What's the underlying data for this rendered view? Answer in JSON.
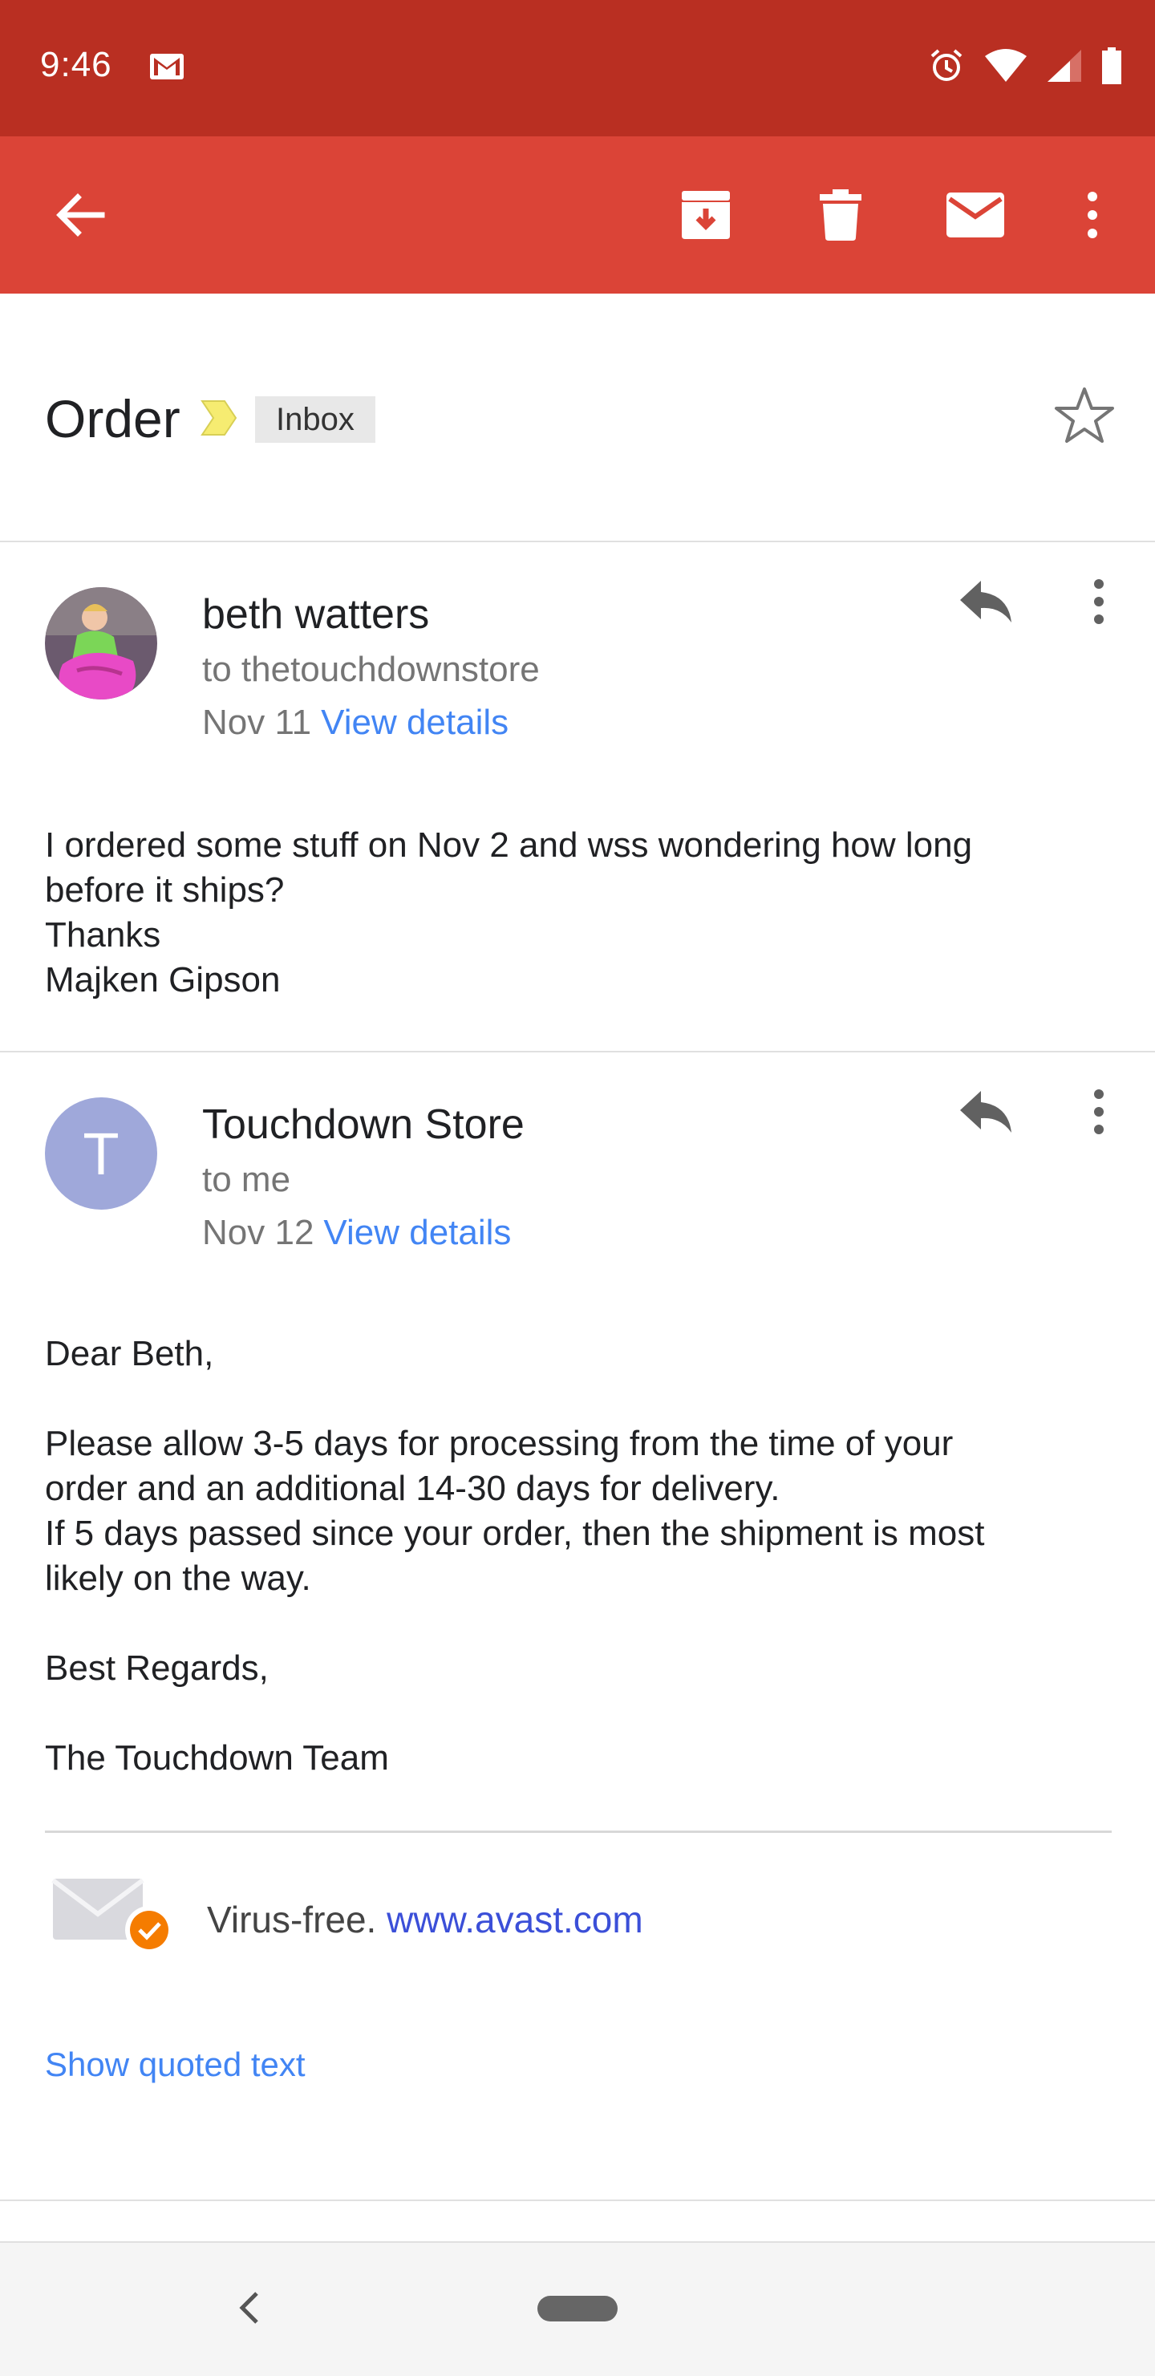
{
  "status_bar": {
    "time": "9:46",
    "background": "#b92f22"
  },
  "app_bar": {
    "background": "#db4437",
    "icons": [
      "back-arrow-icon",
      "archive-icon",
      "delete-icon",
      "mail-icon",
      "more-vert-icon"
    ]
  },
  "thread": {
    "subject": "Order",
    "label": "Inbox"
  },
  "messages": [
    {
      "sender": "beth watters",
      "recipient": "to thetouchdownstore",
      "date": "Nov 11",
      "details_link": "View details",
      "body": "I ordered some stuff on Nov 2 and wss wondering how long\nbefore it ships?\nThanks\nMajken Gipson"
    },
    {
      "sender": "Touchdown Store",
      "avatar_letter": "T",
      "avatar_color": "#9fa8da",
      "recipient": "to me",
      "date": "Nov 12",
      "details_link": "View details",
      "body": "Dear Beth,\n\nPlease allow 3-5 days for processing from the time of your\norder and an additional 14-30 days for delivery.\nIf 5 days passed since your order, then the shipment is most\nlikely on the way.\n\nBest Regards,\n\nThe Touchdown Team",
      "signature": {
        "prefix": "Virus-free.",
        "link": "www.avast.com"
      },
      "show_quoted": "Show quoted text"
    }
  ],
  "accent": {
    "link": "#4285f4",
    "avast_badge": "#f57c00"
  }
}
